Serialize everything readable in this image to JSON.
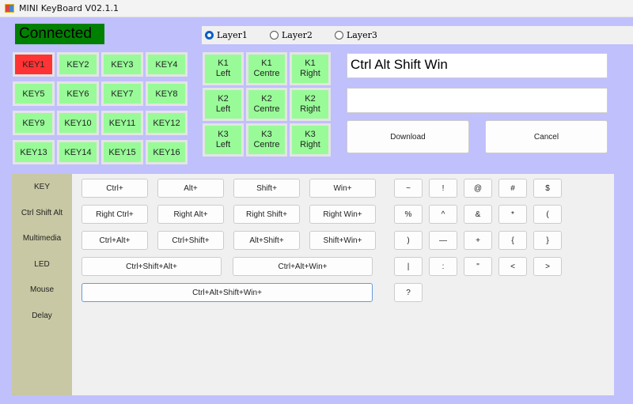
{
  "window": {
    "title": "MINI KeyBoard V02.1.1"
  },
  "status": "Connected",
  "layers": [
    {
      "label": "Layer1",
      "selected": true
    },
    {
      "label": "Layer2",
      "selected": false
    },
    {
      "label": "Layer3",
      "selected": false
    }
  ],
  "keys": [
    "KEY1",
    "KEY2",
    "KEY3",
    "KEY4",
    "KEY5",
    "KEY6",
    "KEY7",
    "KEY8",
    "KEY9",
    "KEY10",
    "KEY11",
    "KEY12",
    "KEY13",
    "KEY14",
    "KEY15",
    "KEY16"
  ],
  "knobs": [
    [
      "K1",
      "Left"
    ],
    [
      "K1",
      "Centre"
    ],
    [
      "K1",
      "Right"
    ],
    [
      "K2",
      "Left"
    ],
    [
      "K2",
      "Centre"
    ],
    [
      "K2",
      "Right"
    ],
    [
      "K3",
      "Left"
    ],
    [
      "K3",
      "Centre"
    ],
    [
      "K3",
      "Right"
    ]
  ],
  "key_display": "Ctrl Alt Shift Win",
  "key_display2": "",
  "download": "Download",
  "cancel": "Cancel",
  "sidebar": [
    "KEY",
    "Ctrl Shift Alt",
    "Multimedia",
    "LED",
    "Mouse",
    "Delay"
  ],
  "modifiers": [
    [
      "Ctrl+",
      "Alt+",
      "Shift+",
      "Win+"
    ],
    [
      "Right  Ctrl+",
      "Right Alt+",
      "Right Shift+",
      "Right Win+"
    ],
    [
      "Ctrl+Alt+",
      "Ctrl+Shift+",
      "Alt+Shift+",
      "Shift+Win+"
    ],
    [
      "Ctrl+Shift+Alt+",
      "Ctrl+Alt+Win+"
    ],
    [
      "Ctrl+Alt+Shift+Win+"
    ]
  ],
  "symbols": [
    [
      "~",
      "!",
      "@",
      "#",
      "$"
    ],
    [
      "%",
      "^",
      "&",
      "*",
      "("
    ],
    [
      ")",
      "—",
      "+",
      "{",
      "}"
    ],
    [
      "|",
      ":",
      "\"",
      "<",
      ">"
    ],
    [
      "?"
    ]
  ]
}
